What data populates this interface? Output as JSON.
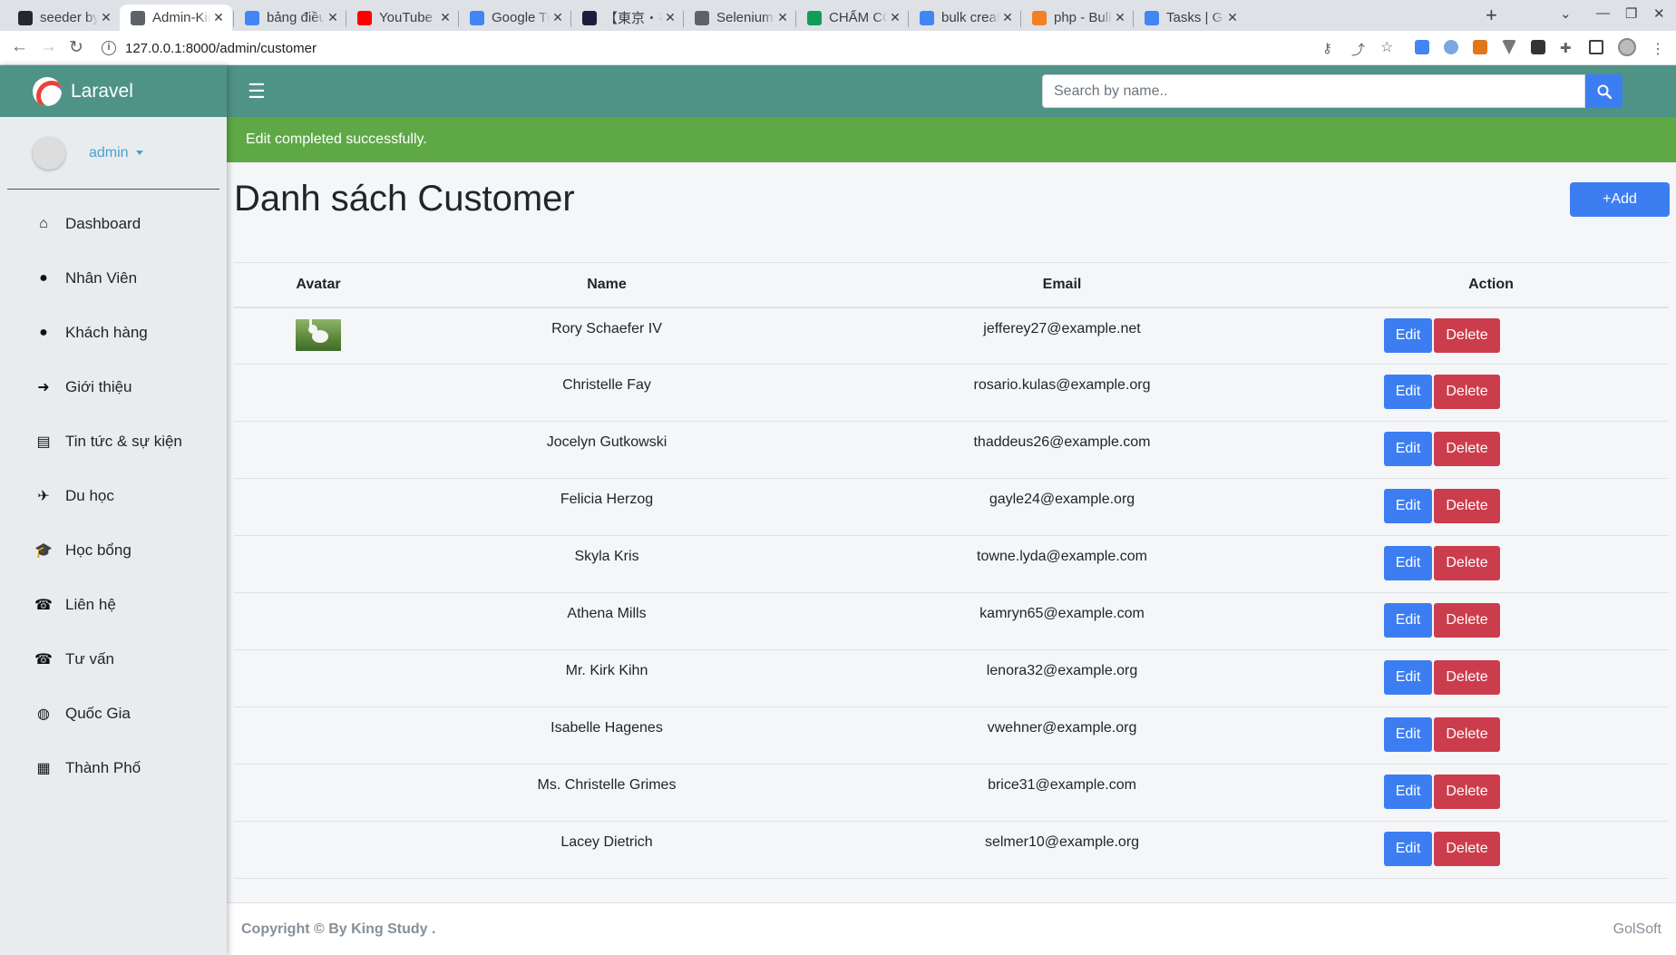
{
  "browser": {
    "tabs": [
      {
        "title": "seeder by Ph",
        "favicon_color": "#24292f",
        "icon": "github-icon"
      },
      {
        "title": "Admin-King",
        "favicon_color": "#5f6368",
        "icon": "globe-icon",
        "active": true
      },
      {
        "title": "bảng điều k",
        "favicon_color": "#4285f4",
        "icon": "google-icon"
      },
      {
        "title": "YouTube",
        "favicon_color": "#ff0000",
        "icon": "youtube-icon"
      },
      {
        "title": "Google Tran",
        "favicon_color": "#4285f4",
        "icon": "translate-icon"
      },
      {
        "title": "【東京・神",
        "favicon_color": "#1d1d3b",
        "icon": "d-icon"
      },
      {
        "title": "Selenium wi",
        "favicon_color": "#5f6368",
        "icon": "doc-icon"
      },
      {
        "title": "CHẤM CÔN",
        "favicon_color": "#0f9d58",
        "icon": "sheets-icon"
      },
      {
        "title": "bulk create",
        "favicon_color": "#4285f4",
        "icon": "google-icon"
      },
      {
        "title": "php - Bulk In",
        "favicon_color": "#f48024",
        "icon": "stackoverflow-icon"
      },
      {
        "title": "Tasks | GOL",
        "favicon_color": "#4285f4",
        "icon": "google-icon"
      }
    ],
    "url": "127.0.0.1:8000/admin/customer"
  },
  "app": {
    "brand": "Laravel",
    "user": "admin",
    "search_placeholder": "Search by name..",
    "menu": [
      {
        "label": "Dashboard",
        "icon": "home-icon",
        "glyph": "⌂"
      },
      {
        "label": "Nhân Viên",
        "icon": "user-icon",
        "glyph": "●"
      },
      {
        "label": "Khách hàng",
        "icon": "user-icon",
        "glyph": "●"
      },
      {
        "label": "Giới thiệu",
        "icon": "arrow-circle-icon",
        "glyph": "➜"
      },
      {
        "label": "Tin tức & sự kiện",
        "icon": "newspaper-icon",
        "glyph": "▤"
      },
      {
        "label": "Du học",
        "icon": "plane-icon",
        "glyph": "✈"
      },
      {
        "label": "Học bổng",
        "icon": "graduation-cap-icon",
        "glyph": "🎓"
      },
      {
        "label": "Liên hệ",
        "icon": "phone-icon",
        "glyph": "☎"
      },
      {
        "label": "Tư vấn",
        "icon": "phone-icon",
        "glyph": "☎"
      },
      {
        "label": "Quốc Gia",
        "icon": "globe-icon",
        "glyph": "◍"
      },
      {
        "label": "Thành Phố",
        "icon": "building-icon",
        "glyph": "▦"
      }
    ],
    "alert": "Edit completed successfully.",
    "page_title": "Danh sách Customer",
    "add_label": "+Add",
    "table": {
      "headers": [
        "Avatar",
        "Name",
        "Email",
        "Action"
      ],
      "edit_label": "Edit",
      "delete_label": "Delete",
      "rows": [
        {
          "name": "Rory Schaefer IV",
          "email": "jefferey27@example.net",
          "avatar": true
        },
        {
          "name": "Christelle Fay",
          "email": "rosario.kulas@example.org",
          "avatar": false
        },
        {
          "name": "Jocelyn Gutkowski",
          "email": "thaddeus26@example.com",
          "avatar": false
        },
        {
          "name": "Felicia Herzog",
          "email": "gayle24@example.org",
          "avatar": false
        },
        {
          "name": "Skyla Kris",
          "email": "towne.lyda@example.com",
          "avatar": false
        },
        {
          "name": "Athena Mills",
          "email": "kamryn65@example.com",
          "avatar": false
        },
        {
          "name": "Mr. Kirk Kihn",
          "email": "lenora32@example.org",
          "avatar": false
        },
        {
          "name": "Isabelle Hagenes",
          "email": "vwehner@example.org",
          "avatar": false
        },
        {
          "name": "Ms. Christelle Grimes",
          "email": "brice31@example.com",
          "avatar": false
        },
        {
          "name": "Lacey Dietrich",
          "email": "selmer10@example.org",
          "avatar": false
        }
      ]
    },
    "footer": {
      "copyright": "Copyright © By King Study .",
      "brand": "GolSoft"
    },
    "colors": {
      "header": "#4f9387",
      "primary": "#3c7ef2",
      "danger": "#cb3d4c",
      "success": "#5ea846"
    }
  }
}
